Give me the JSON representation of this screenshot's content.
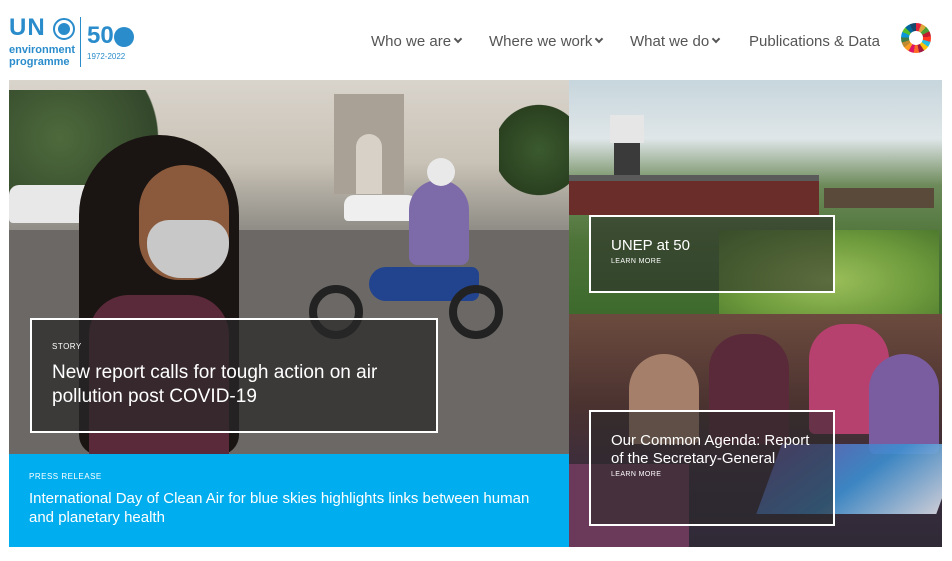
{
  "brand": {
    "name_top": "UN",
    "line1": "environment",
    "line2": "programme",
    "anniversary": "50",
    "years": "1972-2022",
    "accent": "#2a8ccb"
  },
  "nav": {
    "items": [
      {
        "label": "Who we are",
        "has_dropdown": true
      },
      {
        "label": "Where we work",
        "has_dropdown": true
      },
      {
        "label": "What we do",
        "has_dropdown": true
      },
      {
        "label": "Publications & Data",
        "has_dropdown": false
      }
    ],
    "sdg_icon": "sdg-wheel-icon"
  },
  "hero": {
    "label": "STORY",
    "title": "New report calls for tough action on air pollution post COVID-19"
  },
  "press": {
    "label": "PRESS RELEASE",
    "title": "International Day of Clean Air for blue skies highlights links between human and planetary health",
    "color": "#00aeef"
  },
  "panels": [
    {
      "title": "UNEP at 50",
      "cta": "LEARN MORE"
    },
    {
      "title": "Our Common Agenda: Report of the Secretary-General",
      "cta": "LEARN MORE"
    }
  ]
}
